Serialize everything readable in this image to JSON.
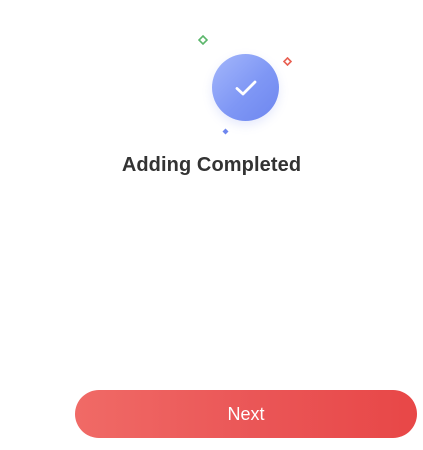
{
  "status": {
    "title": "Adding Completed",
    "icon": "checkmark-circle-icon"
  },
  "actions": {
    "next_label": "Next"
  },
  "colors": {
    "accent_blue": "#7f97f5",
    "button_red": "#e84747",
    "sparkle_green": "#5bb66b",
    "sparkle_red": "#e86052",
    "sparkle_blue": "#6e86ee",
    "title_text": "#333333"
  },
  "icons": {
    "sparkles": [
      "diamond-sparkle-icon",
      "diamond-sparkle-icon",
      "diamond-sparkle-icon"
    ]
  }
}
